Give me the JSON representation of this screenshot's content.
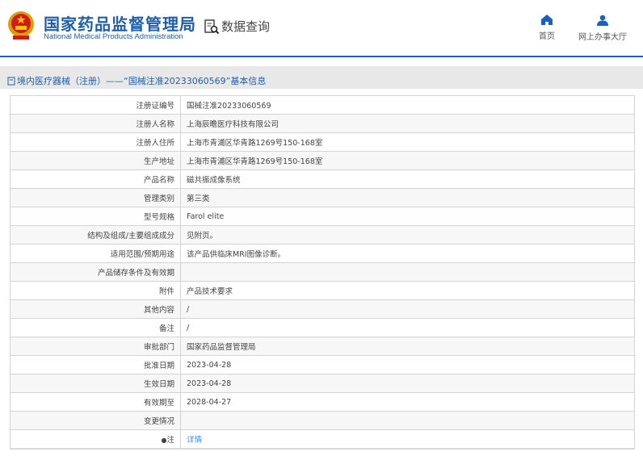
{
  "header": {
    "title_cn": "国家药品监督管理局",
    "title_en": "National Medical Products Administration",
    "query_label": "数据查询",
    "nav": [
      {
        "label": "首页",
        "icon": "home-icon"
      },
      {
        "label": "网上办事大厅",
        "icon": "user-icon"
      }
    ]
  },
  "breadcrumb": {
    "text": "境内医疗器械（注册）——“国械注准20233060569”基本信息"
  },
  "rows": [
    {
      "k": "注册证编号",
      "v": "国械注准20233060569"
    },
    {
      "k": "注册人名称",
      "v": "上海辰瞻医疗科技有限公司"
    },
    {
      "k": "注册人住所",
      "v": "上海市青浦区华青路1269号150-168室"
    },
    {
      "k": "生产地址",
      "v": "上海市青浦区华青路1269号150-168室"
    },
    {
      "k": "产品名称",
      "v": "磁共振成像系统"
    },
    {
      "k": "管理类别",
      "v": "第三类"
    },
    {
      "k": "型号规格",
      "v": "Farol elite"
    },
    {
      "k": "结构及组成/主要组成成分",
      "v": "见附页。"
    },
    {
      "k": "适用范围/预期用途",
      "v": "该产品供临床MRI图像诊断。"
    },
    {
      "k": "产品储存条件及有效期",
      "v": ""
    },
    {
      "k": "附件",
      "v": "产品技术要求"
    },
    {
      "k": "其他内容",
      "v": "/"
    },
    {
      "k": "备注",
      "v": "/"
    },
    {
      "k": "审批部门",
      "v": "国家药品监督管理局"
    },
    {
      "k": "批准日期",
      "v": "2023-04-28"
    },
    {
      "k": "生效日期",
      "v": "2023-04-28"
    },
    {
      "k": "有效期至",
      "v": "2028-04-27"
    },
    {
      "k": "变更情况",
      "v": ""
    }
  ],
  "note": {
    "k": "注",
    "link": "详情"
  }
}
